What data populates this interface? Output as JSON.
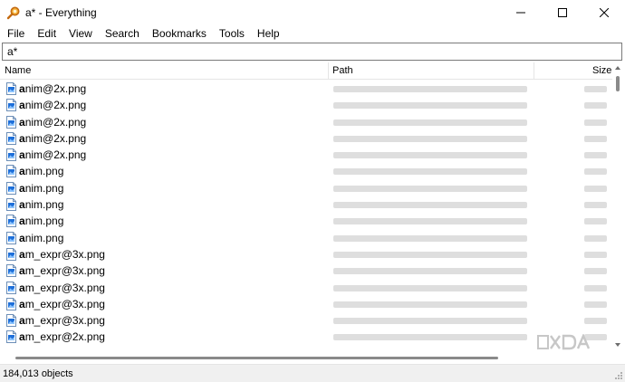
{
  "window": {
    "title": "a* - Everything",
    "buttons": [
      "minimize",
      "maximize",
      "close"
    ]
  },
  "menu": [
    "File",
    "Edit",
    "View",
    "Search",
    "Bookmarks",
    "Tools",
    "Help"
  ],
  "search": {
    "value": "a*"
  },
  "columns": {
    "name": "Name",
    "path": "Path",
    "size": "Size"
  },
  "rows": [
    {
      "prefix": "a",
      "rest": "nim@2x.png"
    },
    {
      "prefix": "a",
      "rest": "nim@2x.png"
    },
    {
      "prefix": "a",
      "rest": "nim@2x.png"
    },
    {
      "prefix": "a",
      "rest": "nim@2x.png"
    },
    {
      "prefix": "a",
      "rest": "nim@2x.png"
    },
    {
      "prefix": "a",
      "rest": "nim.png"
    },
    {
      "prefix": "a",
      "rest": "nim.png"
    },
    {
      "prefix": "a",
      "rest": "nim.png"
    },
    {
      "prefix": "a",
      "rest": "nim.png"
    },
    {
      "prefix": "a",
      "rest": "nim.png"
    },
    {
      "prefix": "a",
      "rest": "m_expr@3x.png"
    },
    {
      "prefix": "a",
      "rest": "m_expr@3x.png"
    },
    {
      "prefix": "a",
      "rest": "m_expr@3x.png"
    },
    {
      "prefix": "a",
      "rest": "m_expr@3x.png"
    },
    {
      "prefix": "a",
      "rest": "m_expr@3x.png"
    },
    {
      "prefix": "a",
      "rest": "m_expr@2x.png"
    }
  ],
  "status": {
    "count": "184,013 objects"
  },
  "icons": {
    "app": "magnifier-icon",
    "file": "png-file-icon"
  },
  "colors": {
    "icon_blue": "#1e6fd9",
    "app_orange": "#e08a1e"
  }
}
